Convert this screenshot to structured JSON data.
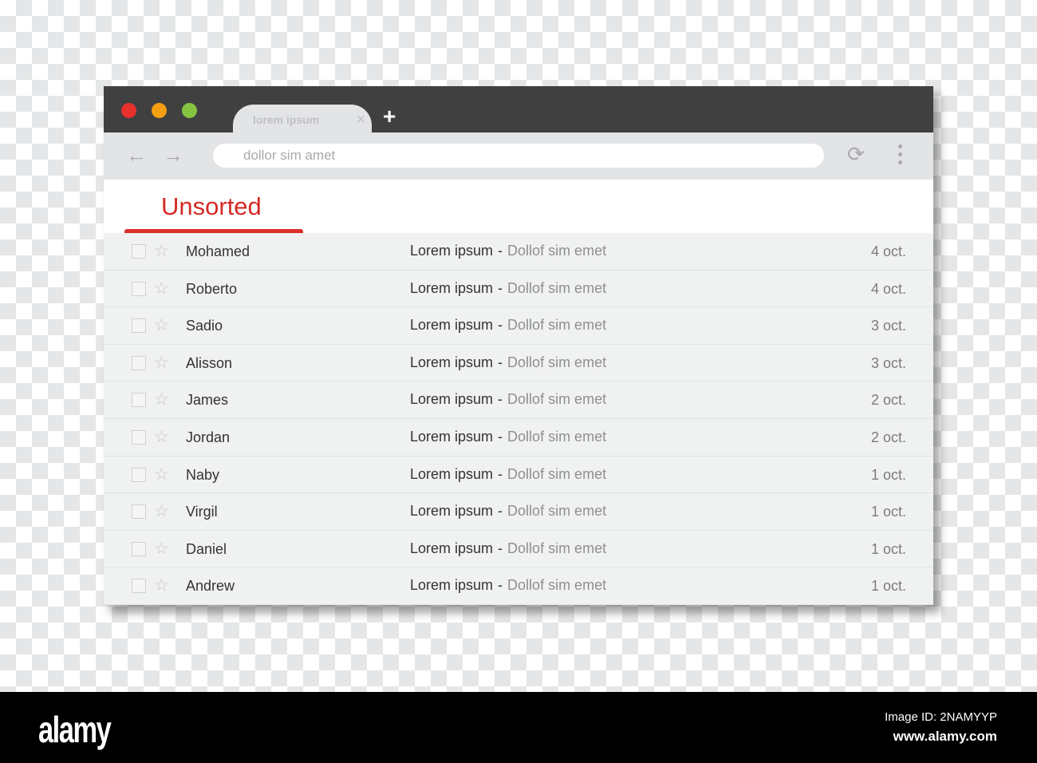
{
  "browser": {
    "tab_title": "lorem ipsum",
    "url_placeholder": "dollor sim amet",
    "traffic_colors": [
      "#e8302c",
      "#f5a012",
      "#84c441"
    ]
  },
  "mail": {
    "heading": "Unsorted",
    "rows": [
      {
        "name": "Mohamed",
        "subject": "Lorem ipsum",
        "snippet": "Dollof sim emet",
        "date": "4 oct."
      },
      {
        "name": "Roberto",
        "subject": "Lorem ipsum",
        "snippet": "Dollof sim emet",
        "date": "4 oct."
      },
      {
        "name": "Sadio",
        "subject": "Lorem ipsum",
        "snippet": "Dollof sim emet",
        "date": "3 oct."
      },
      {
        "name": "Alisson",
        "subject": "Lorem ipsum",
        "snippet": "Dollof sim emet",
        "date": "3 oct."
      },
      {
        "name": "James",
        "subject": "Lorem ipsum",
        "snippet": "Dollof sim emet",
        "date": "2 oct."
      },
      {
        "name": "Jordan",
        "subject": "Lorem ipsum",
        "snippet": "Dollof sim emet",
        "date": "2 oct."
      },
      {
        "name": "Naby",
        "subject": "Lorem ipsum",
        "snippet": "Dollof sim emet",
        "date": "1 oct."
      },
      {
        "name": "Virgil",
        "subject": "Lorem ipsum",
        "snippet": "Dollof sim emet",
        "date": "1 oct."
      },
      {
        "name": "Daniel",
        "subject": "Lorem ipsum",
        "snippet": "Dollof sim emet",
        "date": "1 oct."
      },
      {
        "name": "Andrew",
        "subject": "Lorem ipsum",
        "snippet": "Dollof sim emet",
        "date": "1 oct."
      }
    ]
  },
  "footer": {
    "logo": "alamy",
    "image_id": "Image ID: 2NAMYYP",
    "site": "www.alamy.com"
  }
}
